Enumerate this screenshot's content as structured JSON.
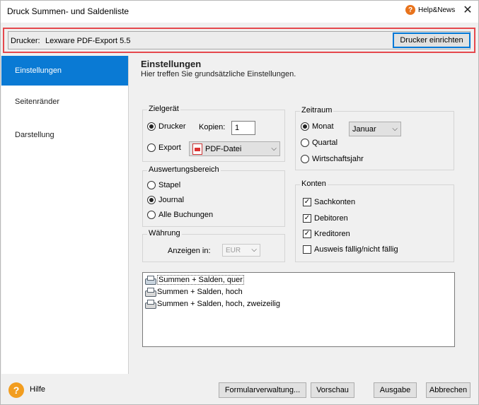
{
  "window": {
    "title": "Druck Summen- und Saldenliste",
    "help_news_label": "Help&News",
    "close_glyph": "✕"
  },
  "printer": {
    "label": "Drucker:",
    "name": "Lexware PDF-Export 5.5",
    "setup_button": "Drucker einrichten",
    "highlight_color": "#e5484d"
  },
  "sidebar": {
    "items": [
      {
        "label": "Einstellungen",
        "active": true
      },
      {
        "label": "Seitenränder",
        "active": false
      },
      {
        "label": "Darstellung",
        "active": false
      }
    ],
    "accent_color": "#0a7ad4"
  },
  "content": {
    "title": "Einstellungen",
    "subtitle": "Hier treffen Sie grundsätzliche Einstellungen."
  },
  "zielgeraet": {
    "legend": "Zielgerät",
    "drucker_label": "Drucker",
    "kopien_label": "Kopien:",
    "kopien_value": "1",
    "export_label": "Export",
    "export_format": "PDF-Datei",
    "selected": "Drucker"
  },
  "auswertungsbereich": {
    "legend": "Auswertungsbereich",
    "options": [
      "Stapel",
      "Journal",
      "Alle Buchungen"
    ],
    "selected": "Journal"
  },
  "waehrung": {
    "legend": "Währung",
    "label": "Anzeigen in:",
    "value": "EUR"
  },
  "zeitraum": {
    "legend": "Zeitraum",
    "monat_label": "Monat",
    "monat_value": "Januar",
    "quartal_label": "Quartal",
    "wirtschaftsjahr_label": "Wirtschaftsjahr",
    "selected": "Monat"
  },
  "konten": {
    "legend": "Konten",
    "items": [
      {
        "label": "Sachkonten",
        "checked": true
      },
      {
        "label": "Debitoren",
        "checked": true
      },
      {
        "label": "Kreditoren",
        "checked": true
      },
      {
        "label": "Ausweis fällig/nicht fällig",
        "checked": false
      }
    ]
  },
  "layouts": {
    "items": [
      {
        "label": "Summen + Salden, quer",
        "selected": true
      },
      {
        "label": "Summen + Salden, hoch",
        "selected": false
      },
      {
        "label": "Summen + Salden, hoch, zweizeilig",
        "selected": false
      }
    ]
  },
  "footer": {
    "help_label": "Hilfe",
    "help_glyph": "?",
    "formular_button": "Formularverwaltung...",
    "vorschau_button": "Vorschau",
    "ausgabe_button": "Ausgabe",
    "abbrechen_button": "Abbrechen"
  },
  "icons": {
    "help": "help-icon",
    "close": "close-icon",
    "pdf": "pdf-file-icon",
    "printer": "printer-icon",
    "dropdown": "chevron-down-icon"
  }
}
